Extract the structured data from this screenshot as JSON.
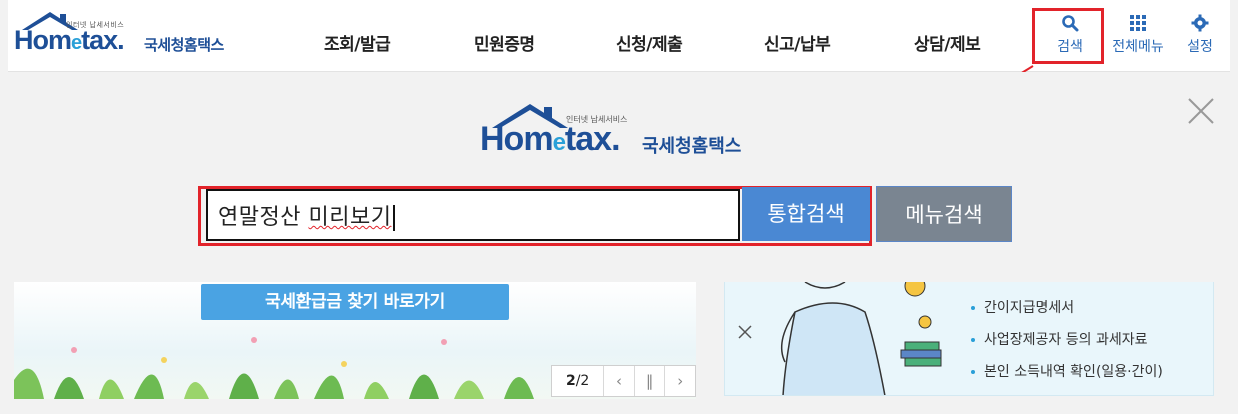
{
  "header": {
    "logo": {
      "tagline": "인터넷 납세서비스",
      "brand_home": "Hom",
      "brand_e": "e",
      "brand_tax": "tax.",
      "brand_kr": "국세청홈택스"
    },
    "nav": [
      {
        "label": "조회/발급"
      },
      {
        "label": "민원증명"
      },
      {
        "label": "신청/제출"
      },
      {
        "label": "신고/납부"
      },
      {
        "label": "상담/제보"
      }
    ],
    "util": {
      "search_label": "검색",
      "search_icon": "search-icon",
      "allmenu_label": "전체메뉴",
      "allmenu_icon": "grid-icon",
      "settings_label": "설정",
      "settings_icon": "gear-icon"
    }
  },
  "search_panel": {
    "logo": {
      "tagline": "인터넷 납세서비스",
      "brand_home": "Hom",
      "brand_e": "e",
      "brand_tax": "tax.",
      "brand_kr": "국세청홈택스"
    },
    "close_icon": "close-icon",
    "input_value_plain": "연말정산 ",
    "input_value_marked": "미리보기",
    "unified_search_label": "통합검색",
    "menu_search_label": "메뉴검색"
  },
  "banner": {
    "button_label": "국세환급금 찾기 바로가기",
    "pager": {
      "current": "2",
      "total": "/2",
      "prev_icon": "chevron-left-icon",
      "pause_icon": "pause-icon",
      "next_icon": "chevron-right-icon"
    }
  },
  "info_card": {
    "items": [
      {
        "label": "간이지급명세서"
      },
      {
        "label": "사업장제공자 등의 과세자료"
      },
      {
        "label": "본인 소득내역 확인(일용·간이)"
      }
    ]
  },
  "colors": {
    "brand_blue": "#1e4f97",
    "accent_blue": "#4a88d3",
    "menu_gray": "#7a8591",
    "highlight_red": "#e2232a"
  }
}
